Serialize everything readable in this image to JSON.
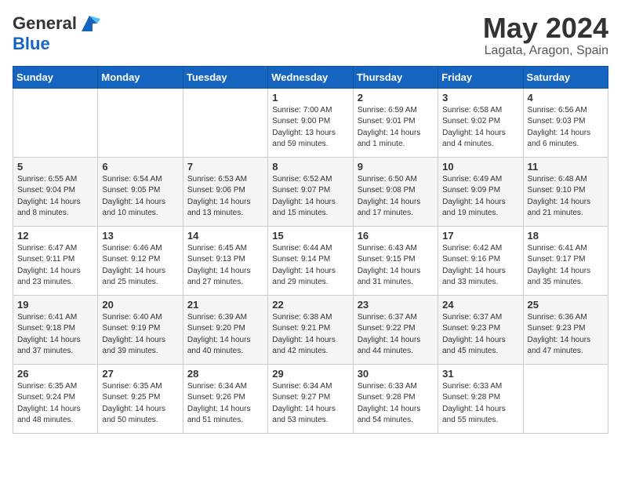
{
  "logo": {
    "general": "General",
    "blue": "Blue"
  },
  "header": {
    "month": "May 2024",
    "location": "Lagata, Aragon, Spain"
  },
  "weekdays": [
    "Sunday",
    "Monday",
    "Tuesday",
    "Wednesday",
    "Thursday",
    "Friday",
    "Saturday"
  ],
  "weeks": [
    [
      {
        "day": "",
        "info": ""
      },
      {
        "day": "",
        "info": ""
      },
      {
        "day": "",
        "info": ""
      },
      {
        "day": "1",
        "info": "Sunrise: 7:00 AM\nSunset: 9:00 PM\nDaylight: 13 hours and 59 minutes."
      },
      {
        "day": "2",
        "info": "Sunrise: 6:59 AM\nSunset: 9:01 PM\nDaylight: 14 hours and 1 minute."
      },
      {
        "day": "3",
        "info": "Sunrise: 6:58 AM\nSunset: 9:02 PM\nDaylight: 14 hours and 4 minutes."
      },
      {
        "day": "4",
        "info": "Sunrise: 6:56 AM\nSunset: 9:03 PM\nDaylight: 14 hours and 6 minutes."
      }
    ],
    [
      {
        "day": "5",
        "info": "Sunrise: 6:55 AM\nSunset: 9:04 PM\nDaylight: 14 hours and 8 minutes."
      },
      {
        "day": "6",
        "info": "Sunrise: 6:54 AM\nSunset: 9:05 PM\nDaylight: 14 hours and 10 minutes."
      },
      {
        "day": "7",
        "info": "Sunrise: 6:53 AM\nSunset: 9:06 PM\nDaylight: 14 hours and 13 minutes."
      },
      {
        "day": "8",
        "info": "Sunrise: 6:52 AM\nSunset: 9:07 PM\nDaylight: 14 hours and 15 minutes."
      },
      {
        "day": "9",
        "info": "Sunrise: 6:50 AM\nSunset: 9:08 PM\nDaylight: 14 hours and 17 minutes."
      },
      {
        "day": "10",
        "info": "Sunrise: 6:49 AM\nSunset: 9:09 PM\nDaylight: 14 hours and 19 minutes."
      },
      {
        "day": "11",
        "info": "Sunrise: 6:48 AM\nSunset: 9:10 PM\nDaylight: 14 hours and 21 minutes."
      }
    ],
    [
      {
        "day": "12",
        "info": "Sunrise: 6:47 AM\nSunset: 9:11 PM\nDaylight: 14 hours and 23 minutes."
      },
      {
        "day": "13",
        "info": "Sunrise: 6:46 AM\nSunset: 9:12 PM\nDaylight: 14 hours and 25 minutes."
      },
      {
        "day": "14",
        "info": "Sunrise: 6:45 AM\nSunset: 9:13 PM\nDaylight: 14 hours and 27 minutes."
      },
      {
        "day": "15",
        "info": "Sunrise: 6:44 AM\nSunset: 9:14 PM\nDaylight: 14 hours and 29 minutes."
      },
      {
        "day": "16",
        "info": "Sunrise: 6:43 AM\nSunset: 9:15 PM\nDaylight: 14 hours and 31 minutes."
      },
      {
        "day": "17",
        "info": "Sunrise: 6:42 AM\nSunset: 9:16 PM\nDaylight: 14 hours and 33 minutes."
      },
      {
        "day": "18",
        "info": "Sunrise: 6:41 AM\nSunset: 9:17 PM\nDaylight: 14 hours and 35 minutes."
      }
    ],
    [
      {
        "day": "19",
        "info": "Sunrise: 6:41 AM\nSunset: 9:18 PM\nDaylight: 14 hours and 37 minutes."
      },
      {
        "day": "20",
        "info": "Sunrise: 6:40 AM\nSunset: 9:19 PM\nDaylight: 14 hours and 39 minutes."
      },
      {
        "day": "21",
        "info": "Sunrise: 6:39 AM\nSunset: 9:20 PM\nDaylight: 14 hours and 40 minutes."
      },
      {
        "day": "22",
        "info": "Sunrise: 6:38 AM\nSunset: 9:21 PM\nDaylight: 14 hours and 42 minutes."
      },
      {
        "day": "23",
        "info": "Sunrise: 6:37 AM\nSunset: 9:22 PM\nDaylight: 14 hours and 44 minutes."
      },
      {
        "day": "24",
        "info": "Sunrise: 6:37 AM\nSunset: 9:23 PM\nDaylight: 14 hours and 45 minutes."
      },
      {
        "day": "25",
        "info": "Sunrise: 6:36 AM\nSunset: 9:23 PM\nDaylight: 14 hours and 47 minutes."
      }
    ],
    [
      {
        "day": "26",
        "info": "Sunrise: 6:35 AM\nSunset: 9:24 PM\nDaylight: 14 hours and 48 minutes."
      },
      {
        "day": "27",
        "info": "Sunrise: 6:35 AM\nSunset: 9:25 PM\nDaylight: 14 hours and 50 minutes."
      },
      {
        "day": "28",
        "info": "Sunrise: 6:34 AM\nSunset: 9:26 PM\nDaylight: 14 hours and 51 minutes."
      },
      {
        "day": "29",
        "info": "Sunrise: 6:34 AM\nSunset: 9:27 PM\nDaylight: 14 hours and 53 minutes."
      },
      {
        "day": "30",
        "info": "Sunrise: 6:33 AM\nSunset: 9:28 PM\nDaylight: 14 hours and 54 minutes."
      },
      {
        "day": "31",
        "info": "Sunrise: 6:33 AM\nSunset: 9:28 PM\nDaylight: 14 hours and 55 minutes."
      },
      {
        "day": "",
        "info": ""
      }
    ]
  ]
}
